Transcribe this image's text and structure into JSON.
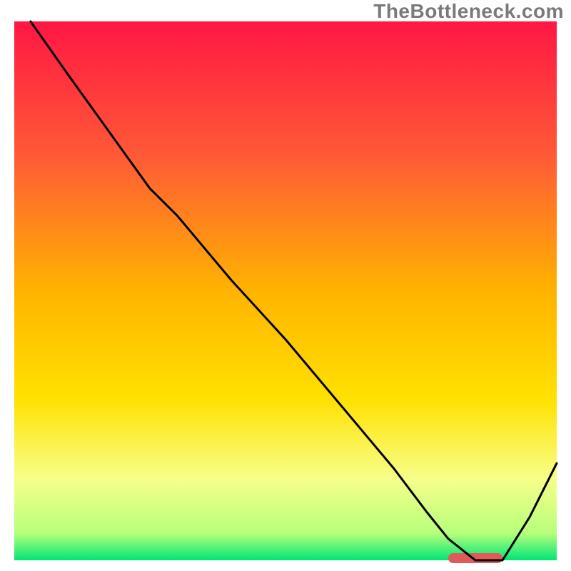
{
  "watermark": "TheBottleneck.com",
  "chart_data": {
    "type": "line",
    "title": "",
    "xlabel": "",
    "ylabel": "",
    "xlim": [
      0,
      100
    ],
    "ylim": [
      0,
      100
    ],
    "series": [
      {
        "name": "bottleneck-curve",
        "x": [
          3,
          10,
          20,
          25,
          30,
          40,
          50,
          60,
          70,
          76,
          80,
          85,
          90,
          95,
          100
        ],
        "y": [
          100,
          90,
          76,
          69,
          64,
          52,
          41,
          29,
          17,
          9,
          4,
          0,
          0,
          8,
          18
        ]
      }
    ],
    "optimal_band": {
      "x_start": 80,
      "x_end": 90,
      "y": 0
    },
    "gradient_stops": [
      {
        "pct": 0,
        "color": "#ff1744"
      },
      {
        "pct": 25,
        "color": "#ff5a36"
      },
      {
        "pct": 50,
        "color": "#ffb300"
      },
      {
        "pct": 70,
        "color": "#ffe100"
      },
      {
        "pct": 85,
        "color": "#f7ff8a"
      },
      {
        "pct": 95,
        "color": "#b6ff7a"
      },
      {
        "pct": 100,
        "color": "#00e676"
      }
    ],
    "axes_visible": false,
    "grid": false
  }
}
